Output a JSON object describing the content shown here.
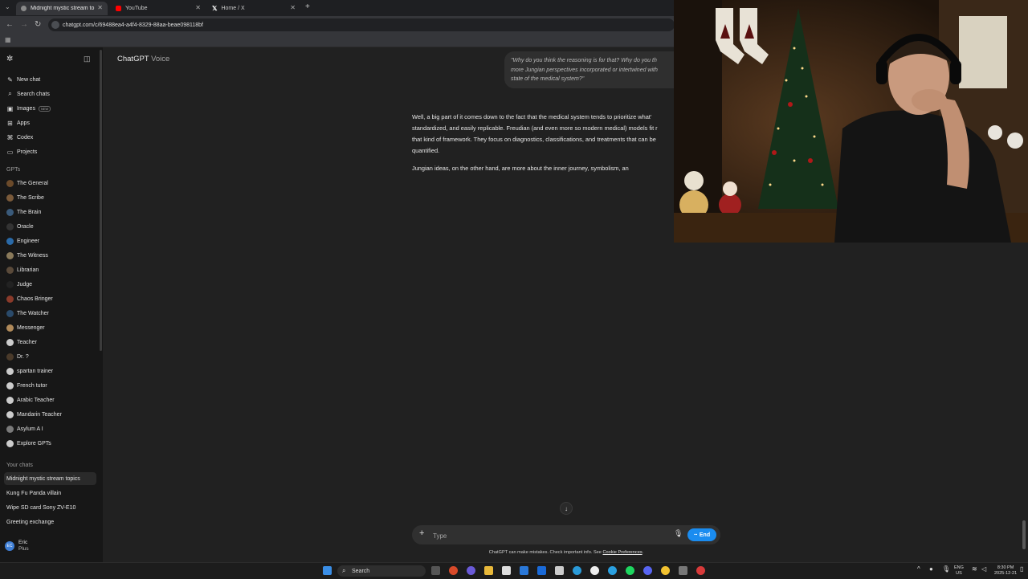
{
  "browser": {
    "tabs": [
      {
        "title": "Midnight mystic stream to",
        "active": true,
        "favicon_color": "#8a8a8a"
      },
      {
        "title": "YouTube",
        "active": false,
        "favicon_color": "#ff0000"
      },
      {
        "title": "Home / X",
        "active": false,
        "favicon_color": "#ffffff"
      }
    ],
    "new_tab": "+",
    "url": "chatgpt.com/c/69488ea4-a4f4-8329-88aa-beae098118bf"
  },
  "sidebar": {
    "top_items": [
      {
        "label": "New chat",
        "icon": "edit-icon"
      },
      {
        "label": "Search chats",
        "icon": "search-icon"
      },
      {
        "label": "Images",
        "icon": "image-icon",
        "badge": "NEW"
      },
      {
        "label": "Apps",
        "icon": "grid-icon"
      },
      {
        "label": "Codex",
        "icon": "code-icon"
      },
      {
        "label": "Projects",
        "icon": "folder-icon"
      }
    ],
    "gpts_heading": "GPTs",
    "gpts": [
      {
        "label": "The General",
        "color": "#6b4a2a"
      },
      {
        "label": "The Scribe",
        "color": "#7a5a3a"
      },
      {
        "label": "The Brain",
        "color": "#3a5a7a"
      },
      {
        "label": "Oracle",
        "color": "#333333"
      },
      {
        "label": "Engineer",
        "color": "#2a6aa8"
      },
      {
        "label": "The Witness",
        "color": "#8a7a5a"
      },
      {
        "label": "Librarian",
        "color": "#5a4a3a"
      },
      {
        "label": "Judge",
        "color": "#222222"
      },
      {
        "label": "Chaos Bringer",
        "color": "#8a3a2a"
      },
      {
        "label": "The Watcher",
        "color": "#2a4a6a"
      },
      {
        "label": "Messenger",
        "color": "#b08a5a"
      },
      {
        "label": "Teacher",
        "color": "#cccccc"
      },
      {
        "label": "Dr. ?",
        "color": "#4a3a2a"
      },
      {
        "label": "spartan trainer",
        "color": "#cccccc"
      },
      {
        "label": "French tutor",
        "color": "#cccccc"
      },
      {
        "label": "Arabic Teacher",
        "color": "#cccccc"
      },
      {
        "label": "Mandarin Teacher",
        "color": "#cccccc"
      },
      {
        "label": "Asylum A I",
        "color": "#7a7a7a"
      },
      {
        "label": "Explore GPTs",
        "color": "#cccccc"
      }
    ],
    "chats_heading": "Your chats",
    "chats": [
      {
        "label": "Midnight mystic stream topics",
        "selected": true
      },
      {
        "label": "Kung Fu Panda villain",
        "selected": false
      },
      {
        "label": "Wipe SD card Sony ZV-E10",
        "selected": false
      },
      {
        "label": "Greeting exchange",
        "selected": false
      }
    ],
    "user": {
      "initials": "EC",
      "name": "Eric",
      "plan": "Plus"
    }
  },
  "main": {
    "title": "ChatGPT",
    "subtitle": "Voice",
    "user_quote": "\"Why do you think the reasoning is for that? Why do you th more Jungian perspectives incorporated or intertwined with state of the medical system?\"",
    "quote_lines": [
      "\"Why do you think the reasoning is for that? Why do you th",
      "more Jungian perspectives incorporated or intertwined with",
      "state of the medical system?\""
    ],
    "answer_para1_lines": [
      "Well, a big part of it comes down to the fact that the medical system tends to prioritize what'",
      "standardized, and easily replicable. Freudian (and even more so modern medical) models fit r",
      "that kind of framework. They focus on diagnostics, classifications, and treatments that can be",
      "quantified."
    ],
    "answer_para2": "Jungian ideas, on the other hand, are more about the inner journey, symbolism, an",
    "scroll_down_icon": "arrow-down-icon"
  },
  "composer": {
    "plus": "+",
    "placeholder": "Type",
    "end_label": "End",
    "disclaimer": "ChatGPT can make mistakes. Check important info. See",
    "disclaimer_link": "Cookie Preferences",
    "disclaimer_end": "."
  },
  "taskbar": {
    "search_label": "Search",
    "lang": "ENG",
    "region": "US",
    "time": "8:30 PM",
    "date": "2025-12-21"
  }
}
